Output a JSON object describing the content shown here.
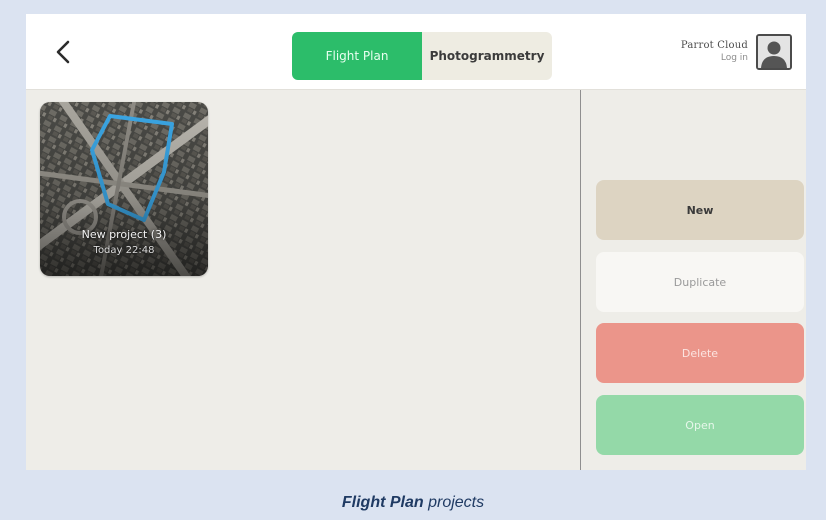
{
  "header": {
    "back_icon": "chevron-left-icon",
    "tabs": [
      {
        "label": "Flight Plan",
        "active": true
      },
      {
        "label": "Photogrammetry",
        "active": false
      }
    ],
    "account": {
      "brand": "Parrot Cloud",
      "login_label": "Log in",
      "avatar_icon": "user-avatar-icon"
    }
  },
  "projects": [
    {
      "name": "New project (3)",
      "date": "Today 22:48"
    }
  ],
  "actions": {
    "new_label": "New",
    "duplicate_label": "Duplicate",
    "delete_label": "Delete",
    "open_label": "Open"
  },
  "colors": {
    "accent_green": "#2cbd6a",
    "new_button": "#ddd4c2",
    "delete_button": "#eb958a",
    "open_button": "#94d9a8",
    "flight_path": "#3ba7e6"
  },
  "caption": {
    "bold": "Flight Plan",
    "rest": " projects"
  }
}
